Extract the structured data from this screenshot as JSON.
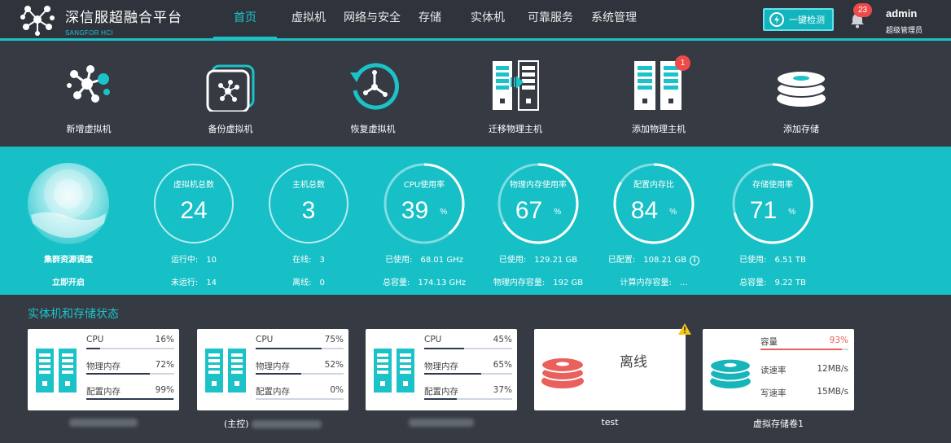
{
  "header": {
    "title": "深信服超融合平台",
    "subtitle": "SANGFOR HCI",
    "nav": [
      {
        "label": "首页",
        "active": true
      },
      {
        "label": "虚拟机",
        "active": false
      },
      {
        "label": "网络与安全",
        "active": false
      },
      {
        "label": "存储",
        "active": false
      },
      {
        "label": "实体机",
        "active": false
      },
      {
        "label": "可靠服务",
        "active": false
      },
      {
        "label": "系统管理",
        "active": false
      }
    ],
    "check_button": "一键检测",
    "notification_count": "23",
    "user": {
      "name": "admin",
      "role": "超级管理员"
    }
  },
  "actions": [
    {
      "label": "新增虚拟机",
      "icon": "network-nodes-icon"
    },
    {
      "label": "备份虚拟机",
      "icon": "backup-icon"
    },
    {
      "label": "恢复虚拟机",
      "icon": "restore-clock-icon"
    },
    {
      "label": "迁移物理主机",
      "icon": "migrate-server-icon"
    },
    {
      "label": "添加物理主机",
      "icon": "server-icon",
      "badge": "1"
    },
    {
      "label": "添加存储",
      "icon": "storage-disk-icon"
    }
  ],
  "stats": {
    "scheduler": {
      "title": "集群资源调度",
      "action": "立即开启"
    },
    "vm_total": {
      "title": "虚拟机总数",
      "value": "24",
      "row1_label": "运行中:",
      "row1_value": "10",
      "row2_label": "未运行:",
      "row2_value": "14"
    },
    "host_total": {
      "title": "主机总数",
      "value": "3",
      "row1_label": "在线:",
      "row1_value": "3",
      "row2_label": "离线:",
      "row2_value": "0"
    },
    "cpu": {
      "title": "CPU使用率",
      "value": "39",
      "unit": "%",
      "percent": 39,
      "row1_label": "已使用:",
      "row1_value": "68.01 GHz",
      "row2_label": "总容量:",
      "row2_value": "174.13 GHz"
    },
    "memory": {
      "title": "物理内存使用率",
      "value": "67",
      "unit": "%",
      "percent": 67,
      "row1_label": "已使用:",
      "row1_value": "129.21 GB",
      "row2_label": "物理内存容量:",
      "row2_value": "192 GB"
    },
    "config_memory": {
      "title": "配置内存比",
      "value": "84",
      "unit": "%",
      "percent": 84,
      "row1_label": "已配置:",
      "row1_value": "108.21 GB",
      "row2_label": "计算内存容量:",
      "row2_value": "..."
    },
    "storage": {
      "title": "存储使用率",
      "value": "71",
      "unit": "%",
      "percent": 71,
      "row1_label": "已使用:",
      "row1_value": "6.51 TB",
      "row2_label": "总容量:",
      "row2_value": "9.22 TB"
    }
  },
  "section_title": "实体机和存储状态",
  "hosts": [
    {
      "name_prefix": "",
      "metrics": [
        {
          "label": "CPU",
          "value": "16%",
          "percent": 16
        },
        {
          "label": "物理内存",
          "value": "72%",
          "percent": 72
        },
        {
          "label": "配置内存",
          "value": "99%",
          "percent": 99
        }
      ]
    },
    {
      "name_prefix": "(主控)",
      "metrics": [
        {
          "label": "CPU",
          "value": "75%",
          "percent": 75
        },
        {
          "label": "物理内存",
          "value": "52%",
          "percent": 52
        },
        {
          "label": "配置内存",
          "value": "0%",
          "percent": 0
        }
      ]
    },
    {
      "name_prefix": "",
      "metrics": [
        {
          "label": "CPU",
          "value": "45%",
          "percent": 45
        },
        {
          "label": "物理内存",
          "value": "65%",
          "percent": 65
        },
        {
          "label": "配置内存",
          "value": "37%",
          "percent": 37
        }
      ]
    }
  ],
  "offline_storage": {
    "status": "离线",
    "name": "test"
  },
  "virtual_storage": {
    "name": "虚拟存储卷1",
    "capacity_label": "容量",
    "capacity_value": "93%",
    "capacity_percent": 93,
    "read_label": "读速率",
    "read_value": "12MB/s",
    "write_label": "写速率",
    "write_value": "15MB/s"
  },
  "colors": {
    "accent": "#1bc3c9",
    "stats_band": "#16c0c6",
    "danger": "#ef4a4a",
    "storage_red": "#e9605c",
    "bar_dark": "#2d3a4f"
  }
}
